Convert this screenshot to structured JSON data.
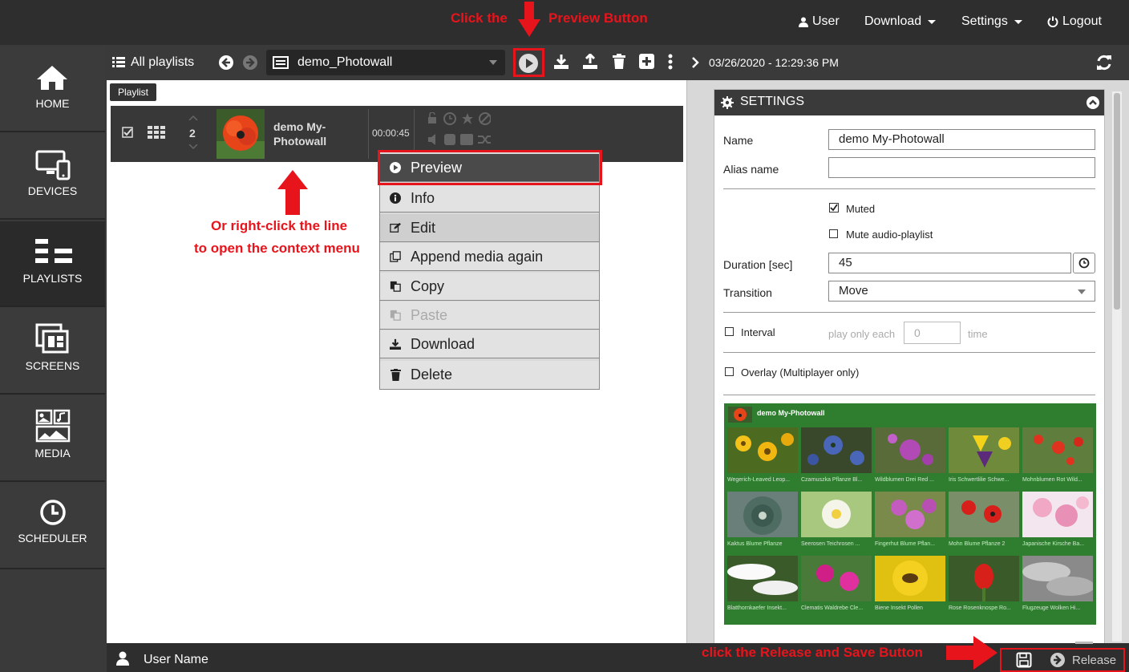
{
  "topbar": {
    "user": "User",
    "download": "Download",
    "settings": "Settings",
    "logout": "Logout"
  },
  "annotations": {
    "click_the": "Click the",
    "preview_button": "Preview Button",
    "right_click_1": "Or right-click the line",
    "right_click_2": "to open the context menu",
    "release_save": "click the Release and Save Button"
  },
  "sidebar": {
    "items": [
      {
        "label": "HOME",
        "icon": "home-icon"
      },
      {
        "label": "DEVICES",
        "icon": "devices-icon"
      },
      {
        "label": "PLAYLISTS",
        "icon": "playlists-icon"
      },
      {
        "label": "SCREENS",
        "icon": "screens-icon"
      },
      {
        "label": "MEDIA",
        "icon": "media-icon"
      },
      {
        "label": "SCHEDULER",
        "icon": "clock-icon"
      }
    ]
  },
  "toolbar": {
    "all_playlists": "All playlists",
    "selected_playlist": "demo_Photowall"
  },
  "list": {
    "tab_label": "Playlist",
    "row": {
      "index": "2",
      "title": "demo My-Photowall",
      "duration": "00:00:45"
    }
  },
  "context_menu": {
    "items": [
      {
        "label": "Preview",
        "icon": "play-icon"
      },
      {
        "label": "Info",
        "icon": "info-icon"
      },
      {
        "label": "Edit",
        "icon": "edit-icon"
      },
      {
        "label": "Append media again",
        "icon": "append-icon"
      },
      {
        "label": "Copy",
        "icon": "copy-icon"
      },
      {
        "label": "Paste",
        "icon": "paste-icon"
      },
      {
        "label": "Download",
        "icon": "download-icon"
      },
      {
        "label": "Delete",
        "icon": "trash-icon"
      }
    ]
  },
  "right_panel": {
    "datetime": "03/26/2020 - 12:29:36 PM",
    "settings_title": "SETTINGS",
    "name_label": "Name",
    "name_value": "demo My-Photowall",
    "alias_label": "Alias name",
    "alias_value": "",
    "muted_label": "Muted",
    "mute_audio_label": "Mute audio-playlist",
    "duration_label": "Duration [sec]",
    "duration_value": "45",
    "transition_label": "Transition",
    "transition_value": "Move",
    "interval_label": "Interval",
    "play_only_each": "play only each",
    "interval_value": "0",
    "time_label": "time",
    "overlay_label": "Overlay (Multiplayer only)",
    "gallery_title": "demo My-Photowall",
    "gallery_items": [
      "Wegerich-Leaved Leop...",
      "Czarnuszka Pflanze Bl...",
      "Wildblumen Drei Red ...",
      "Iris Schwertlilie Schwe...",
      "Mohnblumen Rot Wild...",
      "Kaktus Blume Pflanze",
      "Seerosen Teichrosen ...",
      "Fingerhut Blume Pflan...",
      "Mohn Blume Pflanze 2",
      "Japanische Kirsche Ba...",
      "Blatthornkaefer Insekt...",
      "Clematis Waldrebe Cle...",
      "Biene Insekt Pollen",
      "Rose Rosenknospe Ro...",
      "Flugzeuge Wolken Hi..."
    ]
  },
  "bottombar": {
    "user_name": "User Name",
    "release": "Release"
  },
  "colors": {
    "annotation_red": "#e8141c",
    "dark_bg": "#2e2e2e",
    "gallery_green": "#2f7d2f"
  }
}
